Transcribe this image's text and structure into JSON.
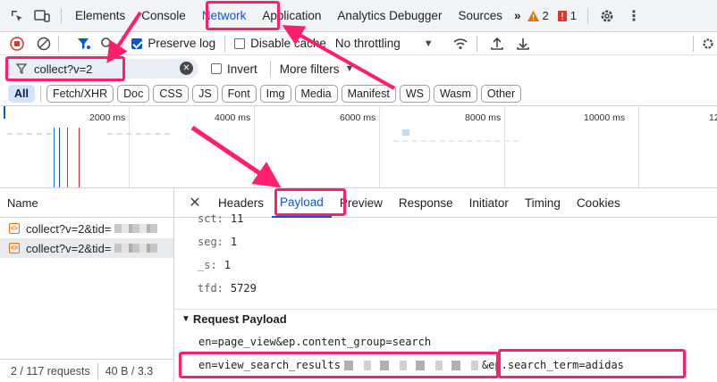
{
  "tabs": {
    "items": [
      "Elements",
      "Console",
      "Network",
      "Application",
      "Analytics Debugger",
      "Sources"
    ],
    "more": "»",
    "warnings": "2",
    "errors": "1"
  },
  "toolbar": {
    "preserve_log": "Preserve log",
    "disable_cache": "Disable cache",
    "throttling": "No throttling"
  },
  "filter": {
    "value": "collect?v=2",
    "invert": "Invert",
    "more_filters": "More filters"
  },
  "types": [
    "All",
    "Fetch/XHR",
    "Doc",
    "CSS",
    "JS",
    "Font",
    "Img",
    "Media",
    "Manifest",
    "WS",
    "Wasm",
    "Other"
  ],
  "timeline": {
    "ticks": [
      "2000 ms",
      "4000 ms",
      "6000 ms",
      "8000 ms",
      "10000 ms",
      "12"
    ]
  },
  "requests": {
    "header": "Name",
    "rows": [
      "collect?v=2&tid=",
      "collect?v=2&tid="
    ],
    "status": "2 / 117 requests",
    "size": "40 B / 3.3"
  },
  "detail": {
    "tabs": [
      "Headers",
      "Payload",
      "Preview",
      "Response",
      "Initiator",
      "Timing",
      "Cookies"
    ],
    "params": [
      {
        "k": "sct:",
        "v": "11"
      },
      {
        "k": "seg:",
        "v": "1"
      },
      {
        "k": "_s:",
        "v": "1"
      },
      {
        "k": "tfd:",
        "v": "5729"
      }
    ],
    "section": "Request Payload",
    "line1": "en=page_view&ep.content_group=search",
    "line2a": "en=view_search_results",
    "line2b": "&ep.search_term=adidas"
  },
  "colors": {
    "accent": "#0b57d0",
    "highlight": "#ff1f6d"
  }
}
